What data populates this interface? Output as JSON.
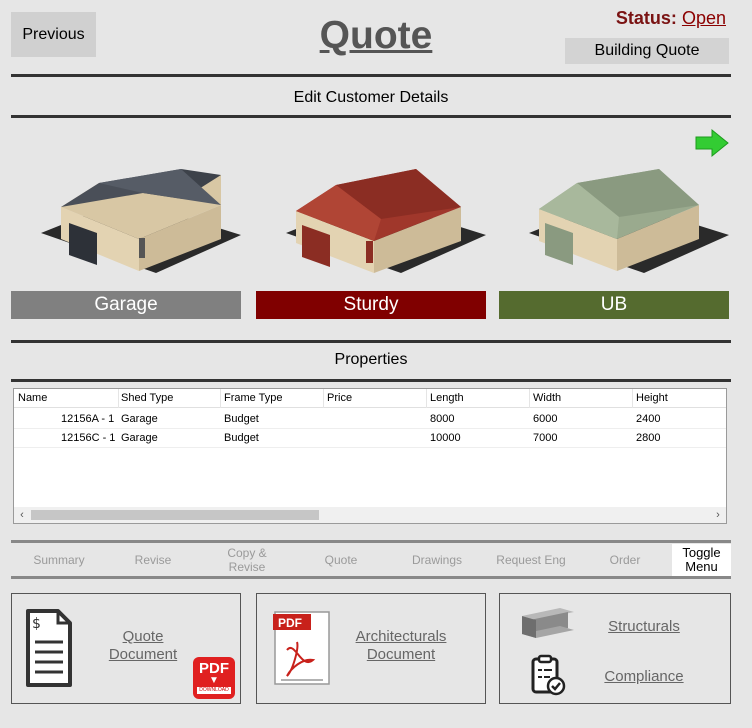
{
  "header": {
    "previous_label": "Previous",
    "title": "Quote",
    "status_label": "Status:",
    "status_value": "Open",
    "building_quote_label": "Building Quote"
  },
  "sections": {
    "customer_details": "Edit Customer Details",
    "properties": "Properties"
  },
  "sheds": [
    {
      "label": "Garage",
      "color": "#808080",
      "roof": "#4a4f58",
      "door": "#2d3138"
    },
    {
      "label": "Sturdy",
      "color": "#800000",
      "roof": "#8b2d23",
      "door": "#8b2d23"
    },
    {
      "label": "UB",
      "color": "#556b2f",
      "roof": "#8a9a80",
      "door": "#8a9a80"
    }
  ],
  "table": {
    "columns": [
      "Name",
      "Shed Type",
      "Frame Type",
      "Price",
      "Length",
      "Width",
      "Height"
    ],
    "rows": [
      [
        "12156A - 1",
        "Garage",
        "Budget",
        "",
        "8000",
        "6000",
        "2400"
      ],
      [
        "12156C - 1",
        "Garage",
        "Budget",
        "",
        "10000",
        "7000",
        "2800"
      ]
    ]
  },
  "nav": {
    "summary": "Summary",
    "revise": "Revise",
    "copy_revise_1": "Copy &",
    "copy_revise_2": "Revise",
    "quote": "Quote",
    "drawings": "Drawings",
    "request_eng": "Request Eng",
    "order": "Order",
    "toggle_1": "Toggle",
    "toggle_2": "Menu"
  },
  "documents": {
    "quote_doc_1": "Quote",
    "quote_doc_2": "Document",
    "pdf_label": "PDF",
    "download_label": "DOWNLOAD",
    "arch_1": "Architecturals",
    "arch_2": "Document",
    "structurals": "Structurals",
    "compliance": "Compliance"
  },
  "colors": {
    "status": "#8b0000",
    "next_arrow": "#33cc33"
  }
}
